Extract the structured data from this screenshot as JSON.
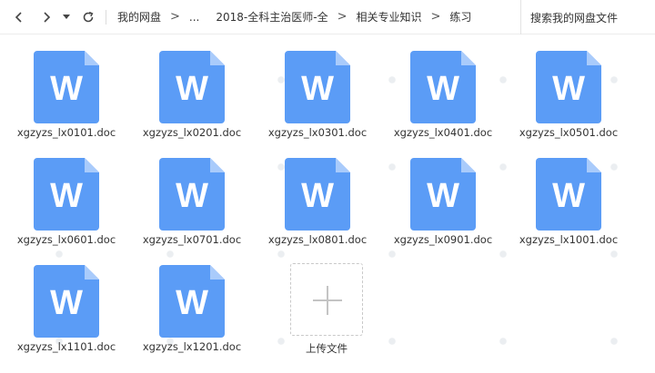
{
  "toolbar": {
    "breadcrumbs": [
      "我的网盘",
      "...",
      "2018-全科主治医师-全",
      "相关专业知识",
      "练习"
    ],
    "separator": ">",
    "search_placeholder": "搜索我的网盘文件"
  },
  "files": [
    {
      "name": "xgzyzs_lx0101.doc",
      "icon_letter": "W"
    },
    {
      "name": "xgzyzs_lx0201.doc",
      "icon_letter": "W"
    },
    {
      "name": "xgzyzs_lx0301.doc",
      "icon_letter": "W"
    },
    {
      "name": "xgzyzs_lx0401.doc",
      "icon_letter": "W"
    },
    {
      "name": "xgzyzs_lx0501.doc",
      "icon_letter": "W"
    },
    {
      "name": "xgzyzs_lx0601.doc",
      "icon_letter": "W"
    },
    {
      "name": "xgzyzs_lx0701.doc",
      "icon_letter": "W"
    },
    {
      "name": "xgzyzs_lx0801.doc",
      "icon_letter": "W"
    },
    {
      "name": "xgzyzs_lx0901.doc",
      "icon_letter": "W"
    },
    {
      "name": "xgzyzs_lx1001.doc",
      "icon_letter": "W"
    },
    {
      "name": "xgzyzs_lx1101.doc",
      "icon_letter": "W"
    },
    {
      "name": "xgzyzs_lx1201.doc",
      "icon_letter": "W"
    }
  ],
  "upload": {
    "label": "上传文件"
  },
  "colors": {
    "doc_blue": "#5b9cf6",
    "doc_fold": "#a9cbfb",
    "text": "#333333"
  },
  "icons": {
    "back": "chevron-left-icon",
    "forward": "chevron-right-icon",
    "history": "dropdown-triangle-icon",
    "refresh": "refresh-icon",
    "upload": "plus-icon",
    "file": "word-document-icon"
  }
}
